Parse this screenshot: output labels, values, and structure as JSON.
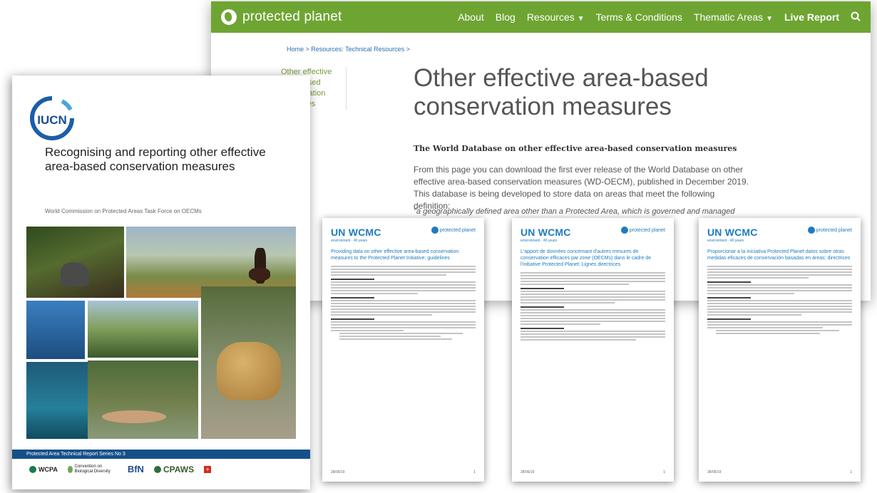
{
  "site": {
    "brand": "protected planet",
    "nav": [
      {
        "label": "About"
      },
      {
        "label": "Blog"
      },
      {
        "label": "Resources",
        "chevron": true
      },
      {
        "label": "Terms & Conditions"
      },
      {
        "label": "Thematic Areas",
        "chevron": true
      },
      {
        "label": "Live Report",
        "bold": true
      }
    ],
    "nav_color": "#6ea532",
    "breadcrumb": "Home > Resources: Technical Resources >",
    "side_link": "Other effective area-based conservation measures",
    "heading": "Other effective area-based conservation measures",
    "subheading": "The World Database on other effective area-based conservation measures",
    "intro": "From this page you can download the first ever release of the World Database on other effective area-based conservation measures (WD-OECM), published in December 2019. This database is being developed to store data on areas that meet the following definition:",
    "quote": "\"a geographically defined area other than a Protected Area, which is governed and managed"
  },
  "cover": {
    "org": "IUCN",
    "title": "Recognising and reporting other effective area-based conservation measures",
    "subtitle": "World Commission on Protected Areas Task Force on OECMs",
    "series": "Protected Area Technical Report Series No 3",
    "partners": [
      "WCPA",
      "Convention on Biological Diversity",
      "BfN",
      "CPAWS"
    ],
    "bar_color": "#16508a"
  },
  "docs": [
    {
      "title": "Providing data on other effective area-based conservation measures to the Protected Planet Initiative: guidelines",
      "date": "28/06/19",
      "page": "1"
    },
    {
      "title": "L'apport de données concernant d'autres mesures de conservation efficaces par zone (OECMs) dans le cadre de l'initiative Protected Planet: Lignes directrices",
      "date": "28/06/19",
      "page": "1"
    },
    {
      "title": "Proporcionar a la iniciativa Protected Planet datos sobre otras medidas eficaces de conservación basadas en áreas: directrices",
      "date": "28/06/19",
      "page": "1"
    }
  ],
  "doc_brand": {
    "org": "UN WCMC",
    "env": "environment · 40 years",
    "pp": "protected planet",
    "color": "#1d7cbf"
  }
}
